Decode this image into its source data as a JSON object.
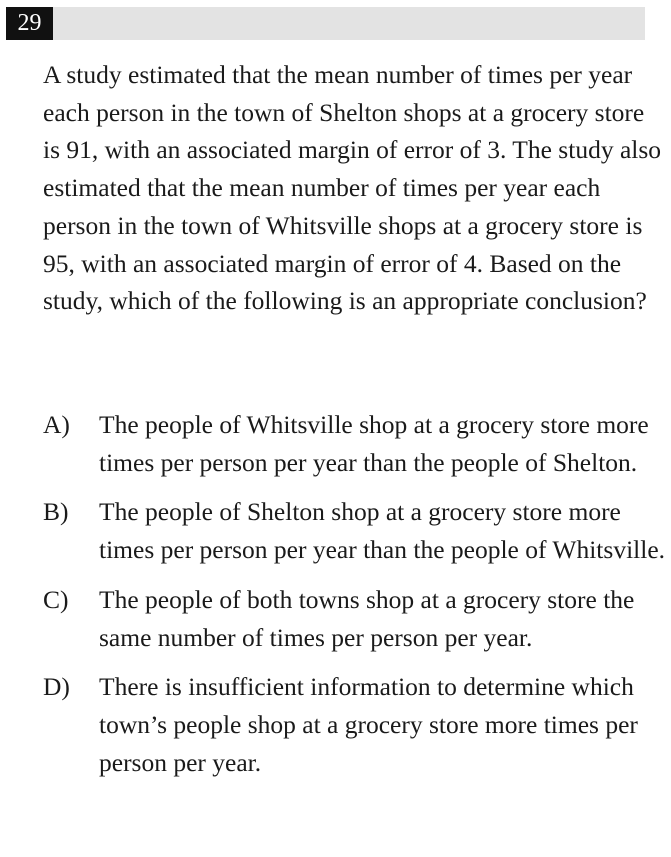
{
  "question": {
    "number": "29",
    "stem": "A study estimated that the mean number of times per year each person in the town of Shelton shops at a grocery store is 91, with an associated margin of error of 3. The study also estimated that the mean number of times per year each person in the town of Whitsville shops at a grocery store is 95, with an associated margin of error of 4. Based on the study, which of the following is an appropriate conclusion?",
    "choices": [
      {
        "letter": "A)",
        "text": "The people of Whitsville shop at a grocery store more times per person per year than the people of Shelton."
      },
      {
        "letter": "B)",
        "text": "The people of Shelton shop at a grocery store more times per person per year than the people of Whitsville."
      },
      {
        "letter": "C)",
        "text": "The people of both towns shop at a grocery store the same number of times per person per year."
      },
      {
        "letter": "D)",
        "text": "There is insufficient information to determine which town’s people shop at a grocery store more times per person per year."
      }
    ]
  }
}
